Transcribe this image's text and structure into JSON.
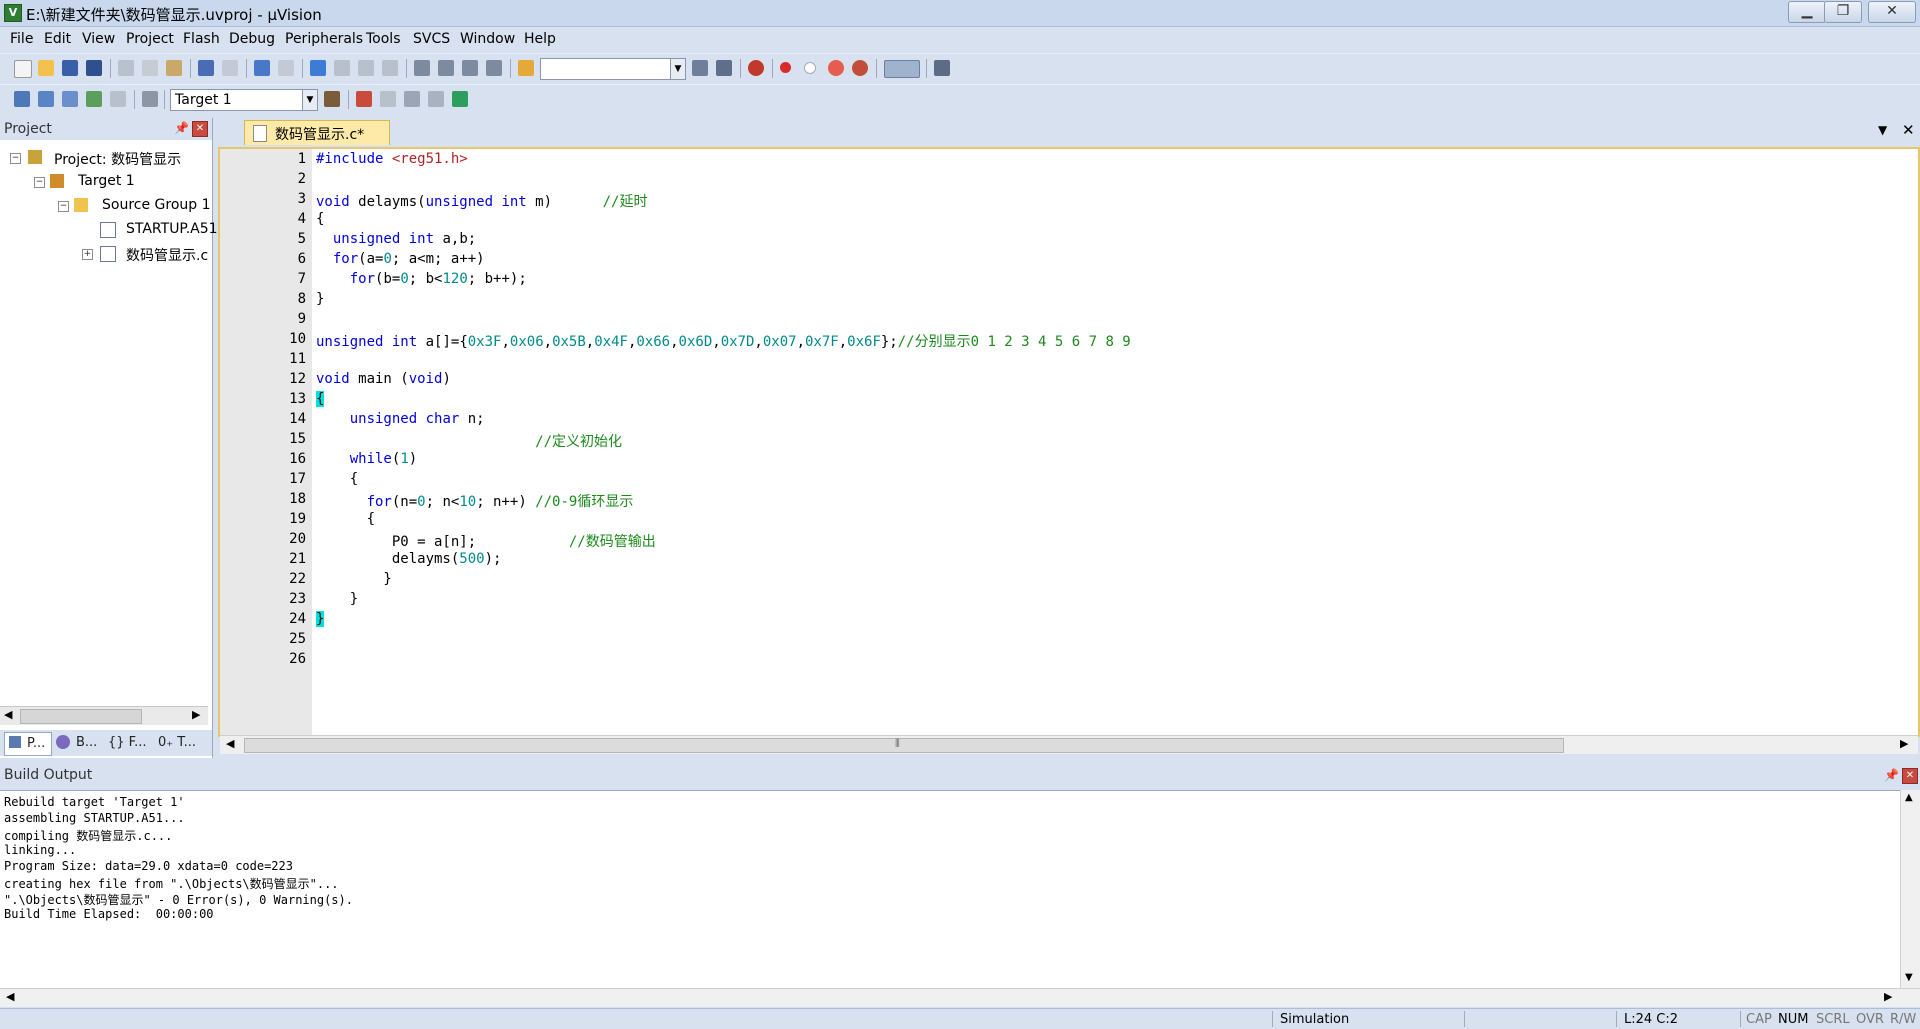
{
  "window": {
    "title": "E:\\新建文件夹\\数码管显示.uvproj - µVision",
    "app_icon": "keil-uvision-icon",
    "controls": [
      "minimize",
      "restore",
      "close"
    ]
  },
  "menu": [
    "File",
    "Edit",
    "View",
    "Project",
    "Flash",
    "Debug",
    "Peripherals",
    "Tools",
    "SVCS",
    "Window",
    "Help"
  ],
  "toolbar2": {
    "target_select": "Target 1"
  },
  "project_panel": {
    "title": "Project",
    "tree": {
      "project": "Project: 数码管显示",
      "target": "Target 1",
      "group": "Source Group 1",
      "files": [
        "STARTUP.A51",
        "数码管显示.c"
      ]
    },
    "tabs": [
      "P...",
      "B...",
      "{} F...",
      "0₊ T..."
    ]
  },
  "editor": {
    "tab_label": "数码管显示.c*",
    "line_numbers": [
      "1",
      "2",
      "3",
      "4",
      "5",
      "6",
      "7",
      "8",
      "9",
      "10",
      "11",
      "12",
      "13",
      "14",
      "15",
      "16",
      "17",
      "18",
      "19",
      "20",
      "21",
      "22",
      "23",
      "24",
      "25",
      "26"
    ],
    "lines": [
      [
        {
          "t": "#include ",
          "c": "kw"
        },
        {
          "t": "<reg51.h>",
          "c": "str"
        }
      ],
      [],
      [
        {
          "t": "void",
          "c": "kw"
        },
        {
          "t": " delayms("
        },
        {
          "t": "unsigned",
          "c": "kw"
        },
        {
          "t": " "
        },
        {
          "t": "int",
          "c": "kw"
        },
        {
          "t": " m)      "
        },
        {
          "t": "//延时",
          "c": "cmt"
        }
      ],
      [
        {
          "t": "{"
        }
      ],
      [
        {
          "t": "  "
        },
        {
          "t": "unsigned",
          "c": "kw"
        },
        {
          "t": " "
        },
        {
          "t": "int",
          "c": "kw"
        },
        {
          "t": " a,b;"
        }
      ],
      [
        {
          "t": "  "
        },
        {
          "t": "for",
          "c": "kw"
        },
        {
          "t": "(a="
        },
        {
          "t": "0",
          "c": "num"
        },
        {
          "t": "; a<m; a++)"
        }
      ],
      [
        {
          "t": "    "
        },
        {
          "t": "for",
          "c": "kw"
        },
        {
          "t": "(b="
        },
        {
          "t": "0",
          "c": "num"
        },
        {
          "t": "; b<"
        },
        {
          "t": "120",
          "c": "num"
        },
        {
          "t": "; b++);"
        }
      ],
      [
        {
          "t": "}"
        }
      ],
      [],
      [
        {
          "t": "unsigned",
          "c": "kw"
        },
        {
          "t": " "
        },
        {
          "t": "int",
          "c": "kw"
        },
        {
          "t": " a[]={"
        },
        {
          "t": "0x3F",
          "c": "num"
        },
        {
          "t": ","
        },
        {
          "t": "0x06",
          "c": "num"
        },
        {
          "t": ","
        },
        {
          "t": "0x5B",
          "c": "num"
        },
        {
          "t": ","
        },
        {
          "t": "0x4F",
          "c": "num"
        },
        {
          "t": ","
        },
        {
          "t": "0x66",
          "c": "num"
        },
        {
          "t": ","
        },
        {
          "t": "0x6D",
          "c": "num"
        },
        {
          "t": ","
        },
        {
          "t": "0x7D",
          "c": "num"
        },
        {
          "t": ","
        },
        {
          "t": "0x07",
          "c": "num"
        },
        {
          "t": ","
        },
        {
          "t": "0x7F",
          "c": "num"
        },
        {
          "t": ","
        },
        {
          "t": "0x6F",
          "c": "num"
        },
        {
          "t": "};"
        },
        {
          "t": "//分别显示0 1 2 3 4 5 6 7 8 9",
          "c": "cmt"
        }
      ],
      [],
      [
        {
          "t": "void",
          "c": "kw"
        },
        {
          "t": " main ("
        },
        {
          "t": "void",
          "c": "kw"
        },
        {
          "t": ")"
        }
      ],
      [
        {
          "t": "{",
          "c": "brace-hl"
        }
      ],
      [
        {
          "t": "    "
        },
        {
          "t": "unsigned",
          "c": "kw"
        },
        {
          "t": " "
        },
        {
          "t": "char",
          "c": "kw"
        },
        {
          "t": " n;"
        }
      ],
      [
        {
          "t": "                          "
        },
        {
          "t": "//定义初始化",
          "c": "cmt"
        }
      ],
      [
        {
          "t": "    "
        },
        {
          "t": "while",
          "c": "kw"
        },
        {
          "t": "("
        },
        {
          "t": "1",
          "c": "num"
        },
        {
          "t": ")"
        }
      ],
      [
        {
          "t": "    {"
        }
      ],
      [
        {
          "t": "      "
        },
        {
          "t": "for",
          "c": "kw"
        },
        {
          "t": "(n="
        },
        {
          "t": "0",
          "c": "num"
        },
        {
          "t": "; n<"
        },
        {
          "t": "10",
          "c": "num"
        },
        {
          "t": "; n++) "
        },
        {
          "t": "//0-9循环显示",
          "c": "cmt"
        }
      ],
      [
        {
          "t": "      {"
        }
      ],
      [
        {
          "t": "         P0 = a[n];           "
        },
        {
          "t": "//数码管输出",
          "c": "cmt"
        }
      ],
      [
        {
          "t": "         delayms("
        },
        {
          "t": "500",
          "c": "num"
        },
        {
          "t": ");"
        }
      ],
      [
        {
          "t": "        }"
        }
      ],
      [
        {
          "t": "    }"
        }
      ],
      [
        {
          "t": "}",
          "c": "brace-hl"
        }
      ],
      [],
      []
    ]
  },
  "build_output": {
    "title": "Build Output",
    "lines": [
      "Rebuild target 'Target 1'",
      "assembling STARTUP.A51...",
      "compiling 数码管显示.c...",
      "linking...",
      "Program Size: data=29.0 xdata=0 code=223",
      "creating hex file from \".\\Objects\\数码管显示\"...",
      "\".\\Objects\\数码管显示\" - 0 Error(s), 0 Warning(s).",
      "Build Time Elapsed:  00:00:00"
    ]
  },
  "status": {
    "mode": "Simulation",
    "cursor": "L:24 C:2",
    "indicators": [
      "CAP",
      "NUM",
      "SCRL",
      "OVR",
      "R/W"
    ]
  }
}
